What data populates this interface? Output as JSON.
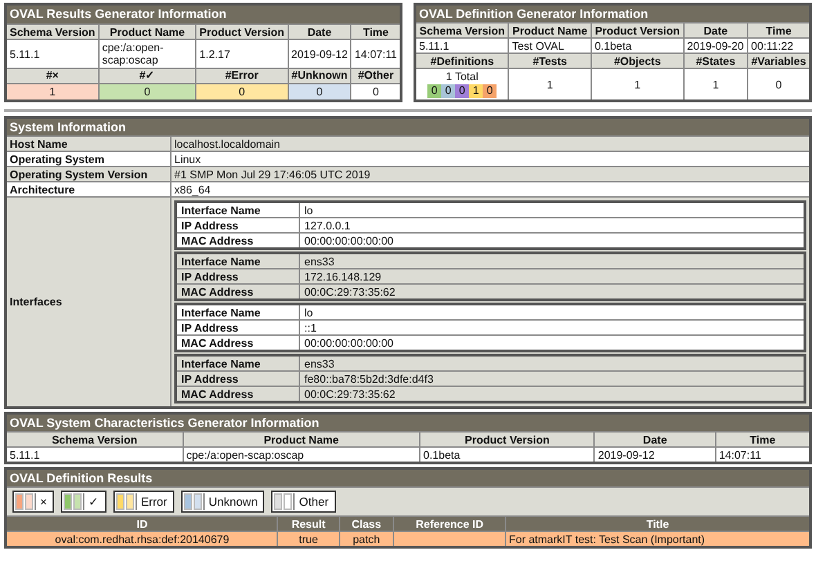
{
  "results_generator": {
    "title": "OVAL Results Generator Information",
    "columns": [
      "Schema Version",
      "Product Name",
      "Product Version",
      "Date",
      "Time"
    ],
    "row": [
      "5.11.1",
      "cpe:/a:open-scap:oscap",
      "1.2.17",
      "2019-09-12",
      "14:07:11"
    ],
    "count_columns": [
      "#×",
      "#✓",
      "#Error",
      "#Unknown",
      "#Other"
    ],
    "counts": [
      {
        "value": "1",
        "color": "#fcd5c4"
      },
      {
        "value": "0",
        "color": "#c6e2ae"
      },
      {
        "value": "0",
        "color": "#ffe6a0"
      },
      {
        "value": "0",
        "color": "#d3e0ef"
      },
      {
        "value": "0",
        "color": "#ffffff"
      }
    ]
  },
  "definition_generator": {
    "title": "OVAL Definition Generator Information",
    "columns": [
      "Schema Version",
      "Product Name",
      "Product Version",
      "Date",
      "Time"
    ],
    "row": [
      "5.11.1",
      "Test OVAL",
      "0.1beta",
      "2019-09-20",
      "00:11:22"
    ],
    "count_columns": [
      "#Definitions",
      "#Tests",
      "#Objects",
      "#States",
      "#Variables"
    ],
    "total": "1 Total",
    "definition_counts": [
      {
        "value": "0",
        "color": "#98cc78"
      },
      {
        "value": "0",
        "color": "#a8c4d8"
      },
      {
        "value": "0",
        "color": "#a07fd8"
      },
      {
        "value": "1",
        "color": "#ffd966"
      },
      {
        "value": "0",
        "color": "#f5a36a"
      }
    ],
    "counts": [
      "1",
      "1",
      "1",
      "0"
    ]
  },
  "system_information": {
    "title": "System Information",
    "rows": [
      {
        "label": "Host Name",
        "value": "localhost.localdomain"
      },
      {
        "label": "Operating System",
        "value": "Linux"
      },
      {
        "label": "Operating System Version",
        "value": "#1 SMP Mon Jul 29 17:46:05 UTC 2019"
      },
      {
        "label": "Architecture",
        "value": "x86_64"
      }
    ],
    "interfaces_label": "Interfaces",
    "interfaces": [
      {
        "rows": [
          {
            "label": "Interface Name",
            "value": "lo"
          },
          {
            "label": "IP Address",
            "value": "127.0.0.1"
          },
          {
            "label": "MAC Address",
            "value": "00:00:00:00:00:00"
          }
        ]
      },
      {
        "rows": [
          {
            "label": "Interface Name",
            "value": "ens33"
          },
          {
            "label": "IP Address",
            "value": "172.16.148.129"
          },
          {
            "label": "MAC Address",
            "value": "00:0C:29:73:35:62"
          }
        ]
      },
      {
        "rows": [
          {
            "label": "Interface Name",
            "value": "lo"
          },
          {
            "label": "IP Address",
            "value": "::1"
          },
          {
            "label": "MAC Address",
            "value": "00:00:00:00:00:00"
          }
        ]
      },
      {
        "rows": [
          {
            "label": "Interface Name",
            "value": "ens33"
          },
          {
            "label": "IP Address",
            "value": "fe80::ba78:5b2d:3dfe:d4f3"
          },
          {
            "label": "MAC Address",
            "value": "00:0C:29:73:35:62"
          }
        ]
      }
    ]
  },
  "system_characteristics": {
    "title": "OVAL System Characteristics Generator Information",
    "columns": [
      "Schema Version",
      "Product Name",
      "Product Version",
      "Date",
      "Time"
    ],
    "row": [
      "5.11.1",
      "cpe:/a:open-scap:oscap",
      "0.1beta",
      "2019-09-12",
      "14:07:11"
    ]
  },
  "definition_results": {
    "title": "OVAL Definition Results",
    "legend": [
      {
        "label": "×",
        "swatches": [
          {
            "color": "#f7a57e"
          },
          {
            "color": "#fcd9cb"
          }
        ]
      },
      {
        "label": "✓",
        "swatches": [
          {
            "color": "#8fc66b"
          },
          {
            "color": "#c6e2ae"
          }
        ]
      },
      {
        "label": "Error",
        "swatches": [
          {
            "color": "#ffd966"
          },
          {
            "color": "#ffe6a0"
          }
        ]
      },
      {
        "label": "Unknown",
        "swatches": [
          {
            "color": "#a8c4e0"
          },
          {
            "color": "#d3e0ef"
          }
        ]
      },
      {
        "label": "Other",
        "swatches": [
          {
            "color": "#e0e0e0"
          },
          {
            "color": "#ffffff"
          }
        ]
      }
    ],
    "columns": [
      "ID",
      "Result",
      "Class",
      "Reference ID",
      "Title"
    ],
    "rows": [
      {
        "id": "oval:com.redhat.rhsa:def:20140679",
        "result": "true",
        "class": "patch",
        "reference_id": "",
        "title": "For atmarkIT test: Test Scan (Important)",
        "color": "#ffbb88"
      }
    ]
  }
}
